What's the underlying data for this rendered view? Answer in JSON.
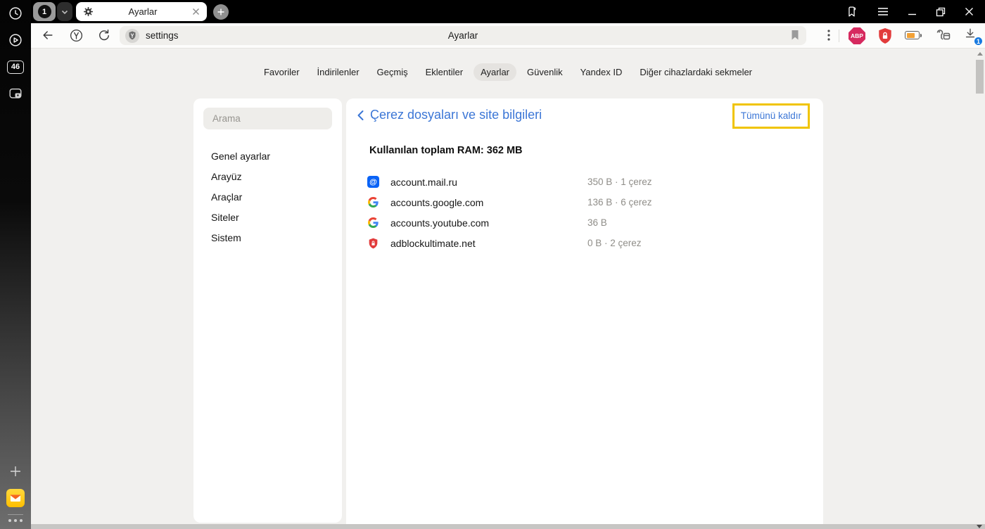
{
  "colors": {
    "accent_blue": "#3b76d6",
    "highlight_yellow": "#f0c400",
    "danger_red": "#e23b3b",
    "abp_pink": "#d62a5f",
    "mailru_blue": "#0a63f6"
  },
  "titlebar": {
    "tab_group_count": "1",
    "tab_title": "Ayarlar"
  },
  "rail": {
    "counter": "46"
  },
  "toolbar": {
    "address_value": "settings",
    "page_title": "Ayarlar",
    "abp_label": "ABP",
    "download_badge": "1"
  },
  "nav": {
    "tabs": [
      "Favoriler",
      "İndirilenler",
      "Geçmiş",
      "Eklentiler",
      "Ayarlar",
      "Güvenlik",
      "Yandex ID",
      "Diğer cihazlardaki sekmeler"
    ]
  },
  "sidebar": {
    "search_placeholder": "Arama",
    "items": [
      "Genel ayarlar",
      "Arayüz",
      "Araçlar",
      "Siteler",
      "Sistem"
    ]
  },
  "content": {
    "title": "Çerez dosyaları ve site bilgileri",
    "remove_all_label": "Tümünü kaldır",
    "ram_total": "Kullanılan toplam RAM: 362 MB",
    "mailru_glyph": "@",
    "sites": [
      {
        "name": "account.mail.ru",
        "info": "350 B · 1 çerez"
      },
      {
        "name": "accounts.google.com",
        "info": "136 B · 6 çerez"
      },
      {
        "name": "accounts.youtube.com",
        "info": "36 B"
      },
      {
        "name": "adblockultimate.net",
        "info": "0 B · 2 çerez"
      }
    ]
  }
}
